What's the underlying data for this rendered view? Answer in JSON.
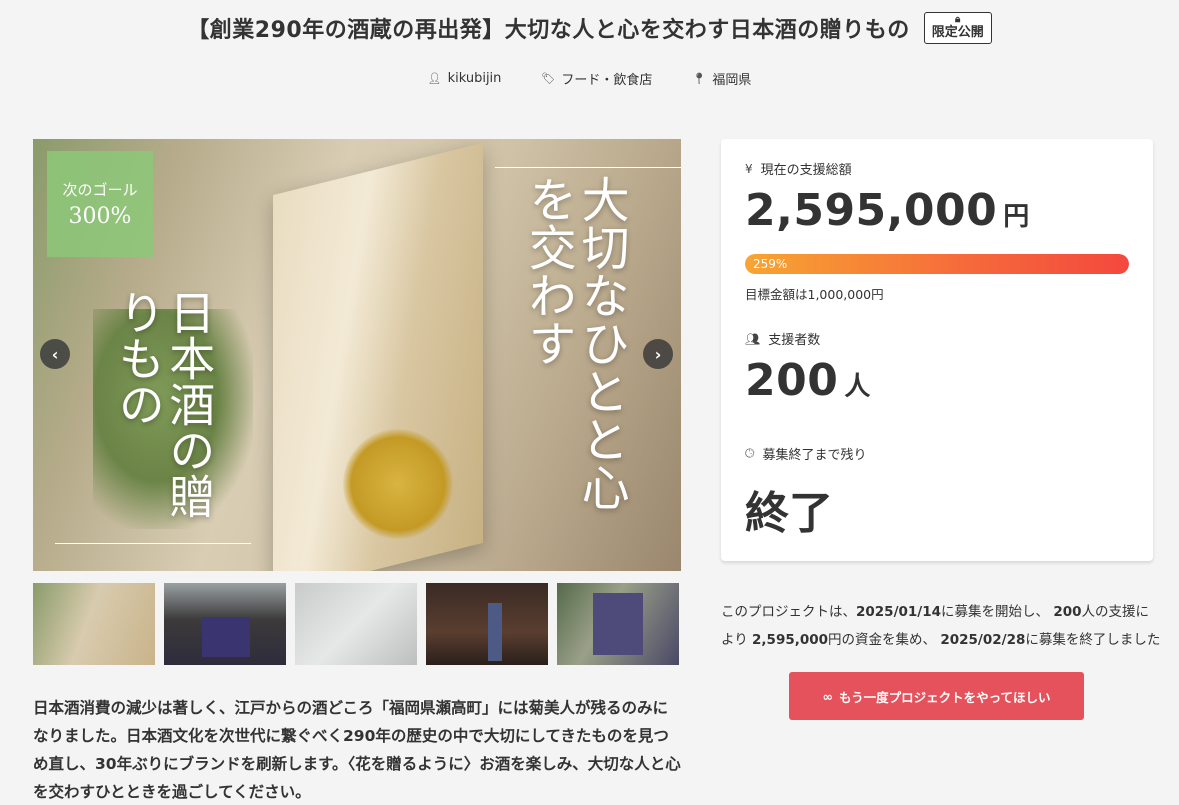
{
  "header": {
    "title": "【創業290年の酒蔵の再出発】大切な人と心を交わす日本酒の贈りもの",
    "badge": "限定公開",
    "owner": "kikubijin",
    "category": "フード・飲食店",
    "location": "福岡県"
  },
  "gallery": {
    "goal_line1": "次のゴール",
    "goal_line2": "300%",
    "headline_right": "大切なひとと心を交わす",
    "headline_left": "日本酒の贈りもの",
    "prev_icon": "‹",
    "next_icon": "›"
  },
  "description": "日本酒消費の減少は著しく、江戸からの酒どころ「福岡県瀬高町」には菊美人が残るのみになりました。日本酒文化を次世代に繋ぐべく290年の歴史の中で大切にしてきたものを見つめ直し、30年ぶりにブランドを刷新します。〈花を贈るように〉お酒を楽しみ、大切な人と心を交わすひとときを過ごしてください。",
  "stats": {
    "total_label": "現在の支援総額",
    "total_value": "2,595,000",
    "total_unit": "円",
    "percent_text": "259%",
    "percent_value": 259,
    "target_text": "目標金額は1,000,000円",
    "supporters_label": "支援者数",
    "supporters_value": "200",
    "supporters_unit": "人",
    "remaining_label": "募集終了まで残り",
    "remaining_value": "終了"
  },
  "summary": {
    "p1": "このプロジェクトは、",
    "start_date": "2025/01/14",
    "p2": "に募集を開始し、",
    "count": "200",
    "p3": "人の支援により",
    "amount": "2,595,000",
    "p4": "円の資金を集め、",
    "end_date": "2025/02/28",
    "p5": "に募集を終了しました"
  },
  "cta": {
    "icon": "∞",
    "label": "もう一度プロジェクトをやってほしい"
  },
  "colors": {
    "cta": "#e5525b",
    "progress_start": "#f7a532",
    "progress_end": "#f4483e"
  }
}
